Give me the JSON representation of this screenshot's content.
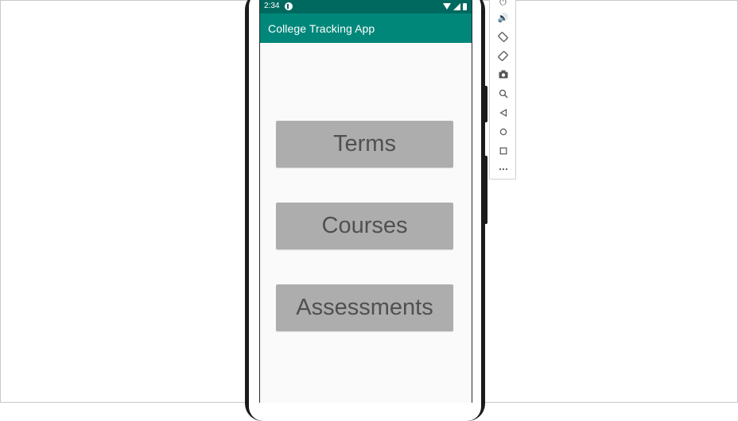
{
  "status_bar": {
    "time": "2:34"
  },
  "app_bar": {
    "title": "College Tracking App"
  },
  "main": {
    "buttons": [
      {
        "label": "Terms"
      },
      {
        "label": "Courses"
      },
      {
        "label": "Assessments"
      }
    ]
  },
  "emulator_toolbar": {
    "tools": [
      {
        "icon": "power-icon"
      },
      {
        "icon": "volume-up-icon"
      },
      {
        "icon": "rotate-left-icon"
      },
      {
        "icon": "rotate-right-icon"
      },
      {
        "icon": "camera-icon"
      },
      {
        "icon": "zoom-icon"
      },
      {
        "icon": "back-icon"
      },
      {
        "icon": "home-icon"
      },
      {
        "icon": "overview-icon"
      },
      {
        "icon": "more-icon"
      }
    ]
  },
  "colors": {
    "status_bar": "#00695f",
    "app_bar": "#00877a",
    "screen_background": "#fafafa",
    "button_background": "#adadad",
    "button_text": "#505050"
  }
}
